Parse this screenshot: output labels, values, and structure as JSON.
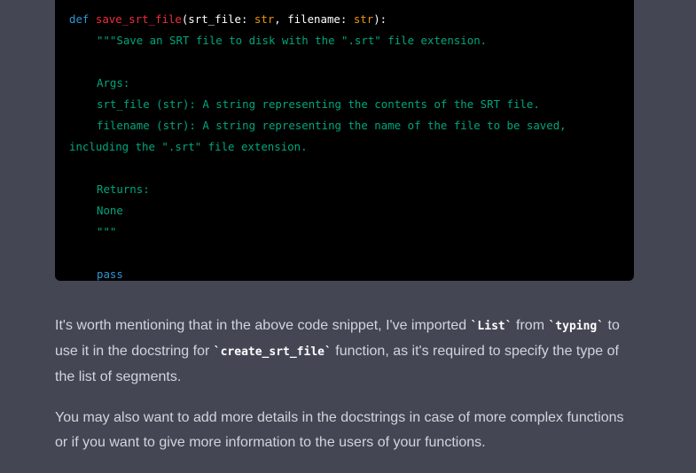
{
  "code": {
    "line1": {
      "def": "def",
      "name": "save_srt_file",
      "open": "(srt_file: ",
      "type1": "str",
      "mid": ", filename: ",
      "type2": "str",
      "close": "):"
    },
    "line2": "\"\"\"Save an SRT file to disk with the \".srt\" file extension.",
    "line4": "Args:",
    "line5": "srt_file (str): A string representing the contents of the SRT file.",
    "line6": "filename (str): A string representing the name of the file to be saved,",
    "line7": "including the \".srt\" file extension.",
    "line9": "Returns:",
    "line10": "None",
    "line11": "\"\"\"",
    "line13": "pass"
  },
  "paragraph1": {
    "t1": "It's worth mentioning that in the above code snippet, I've imported ",
    "code1": "`List`",
    "t2": " from ",
    "code2": "`typing`",
    "t3": " to use it in the docstring for ",
    "code3": "`create_srt_file`",
    "t4": " function, as it's required to specify the type of the list of segments."
  },
  "paragraph2": "You may also want to add more details in the docstrings in case of more complex functions or if you want to give more information to the users of your functions."
}
